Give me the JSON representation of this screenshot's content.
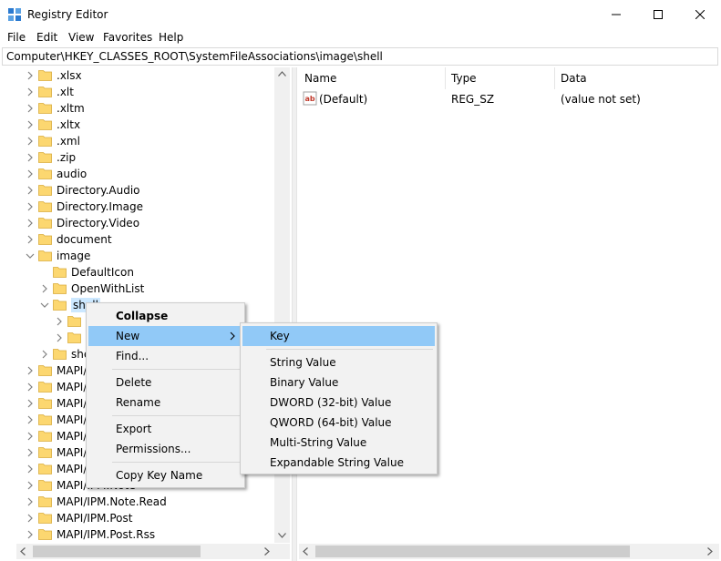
{
  "window": {
    "title": "Registry Editor"
  },
  "menubar": {
    "items": [
      "File",
      "Edit",
      "View",
      "Favorites",
      "Help"
    ]
  },
  "address": {
    "path": "Computer\\HKEY_CLASSES_ROOT\\SystemFileAssociations\\image\\shell"
  },
  "tree": {
    "items": [
      {
        "label": ".xlsx"
      },
      {
        "label": ".xlt"
      },
      {
        "label": ".xltm"
      },
      {
        "label": ".xltx"
      },
      {
        "label": ".xml"
      },
      {
        "label": ".zip"
      },
      {
        "label": "audio"
      },
      {
        "label": "Directory.Audio"
      },
      {
        "label": "Directory.Image"
      },
      {
        "label": "Directory.Video"
      },
      {
        "label": "document"
      },
      {
        "label": "image"
      },
      {
        "label": "DefaultIcon"
      },
      {
        "label": "OpenWithList"
      },
      {
        "label": "shell"
      },
      {
        "label": ""
      },
      {
        "label": ""
      },
      {
        "label": "she"
      },
      {
        "label": "MAPI/"
      },
      {
        "label": "MAPI/"
      },
      {
        "label": "MAPI/"
      },
      {
        "label": "MAPI/"
      },
      {
        "label": "MAPI/"
      },
      {
        "label": "MAPI/"
      },
      {
        "label": "MAPI/"
      },
      {
        "label": "MAPI/IPM.Note"
      },
      {
        "label": "MAPI/IPM.Note.Read"
      },
      {
        "label": "MAPI/IPM.Post"
      },
      {
        "label": "MAPI/IPM.Post.Rss"
      }
    ]
  },
  "list": {
    "columns": [
      "Name",
      "Type",
      "Data"
    ],
    "rows": [
      {
        "name": "(Default)",
        "type": "REG_SZ",
        "data": "(value not set)"
      }
    ]
  },
  "context_menu": {
    "items": [
      "Collapse",
      "New",
      "Find...",
      "Delete",
      "Rename",
      "Export",
      "Permissions...",
      "Copy Key Name"
    ]
  },
  "submenu": {
    "items": [
      "Key",
      "String Value",
      "Binary Value",
      "DWORD (32-bit) Value",
      "QWORD (64-bit) Value",
      "Multi-String Value",
      "Expandable String Value"
    ]
  },
  "colors": {
    "highlight": "#91c9f7",
    "selection": "#cce8ff",
    "folder": "#fcd770"
  }
}
